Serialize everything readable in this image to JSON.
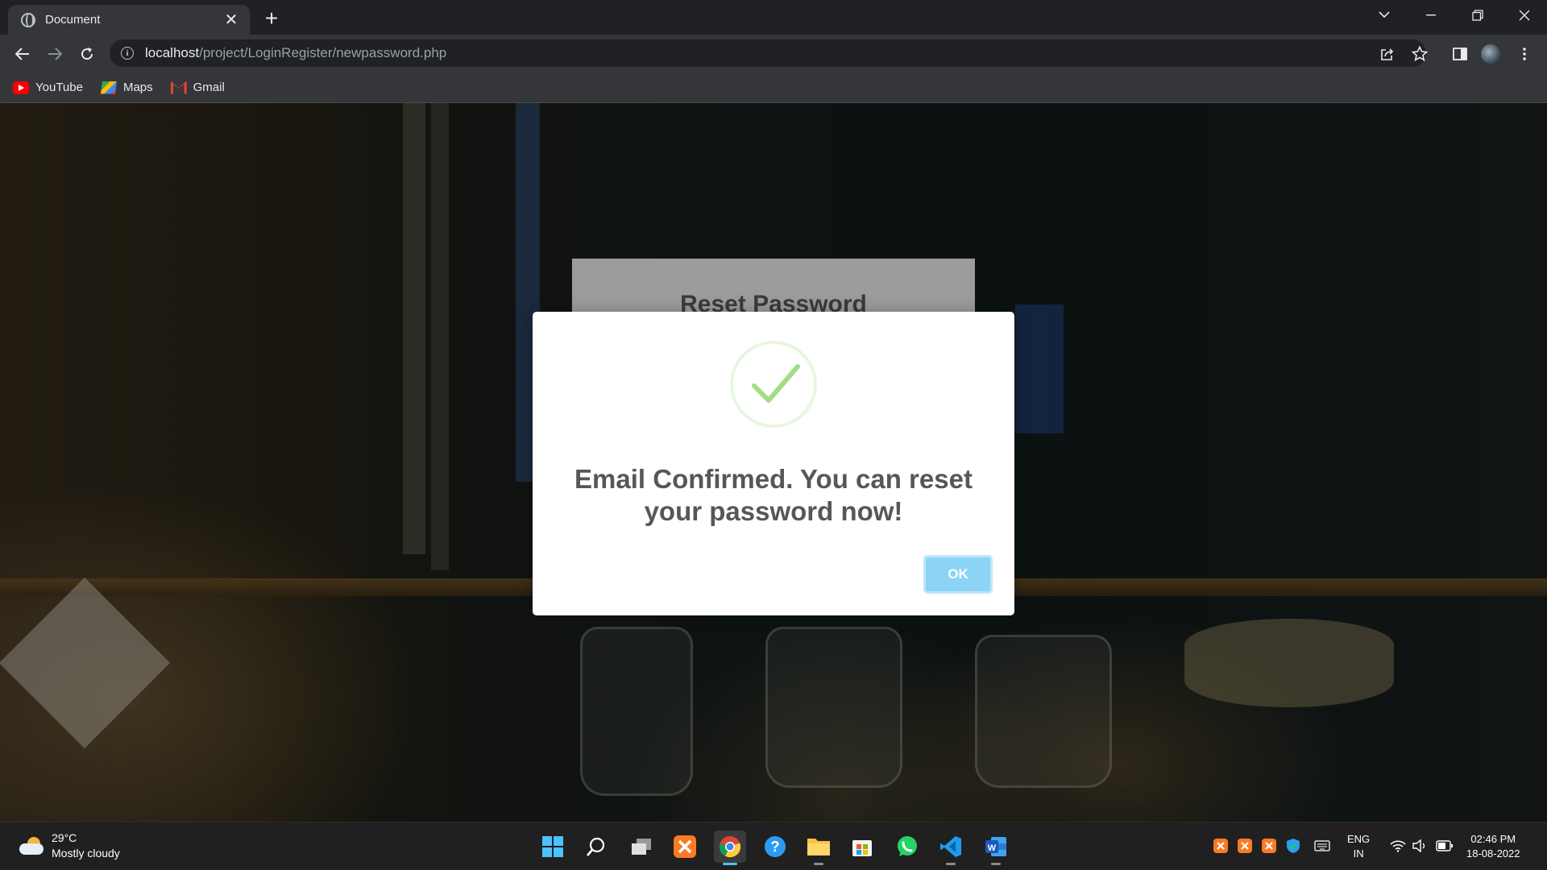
{
  "browser": {
    "tab_title": "Document",
    "tab_close_glyph": "✕",
    "new_tab_glyph": "+",
    "url_host": "localhost",
    "url_path": "/project/LoginRegister/newpassword.php",
    "bookmarks": [
      {
        "label": "YouTube",
        "icon": "youtube-icon"
      },
      {
        "label": "Maps",
        "icon": "maps-icon"
      },
      {
        "label": "Gmail",
        "icon": "gmail-icon"
      }
    ]
  },
  "page": {
    "reset_title": "Reset Password"
  },
  "dialog": {
    "message": "Email Confirmed. You can reset your password now!",
    "ok_label": "OK",
    "icon": "success-check-icon",
    "colors": {
      "check": "#a5dc86",
      "button": "#8cd4f5"
    }
  },
  "taskbar": {
    "weather_temp": "29°C",
    "weather_desc": "Mostly cloudy",
    "apps": [
      "start",
      "search",
      "task-view",
      "xampp",
      "chrome",
      "help",
      "file-explorer",
      "microsoft-store",
      "whatsapp",
      "vscode",
      "word"
    ],
    "lang_top": "ENG",
    "lang_bottom": "IN",
    "time": "02:46 PM",
    "date": "18-08-2022"
  }
}
